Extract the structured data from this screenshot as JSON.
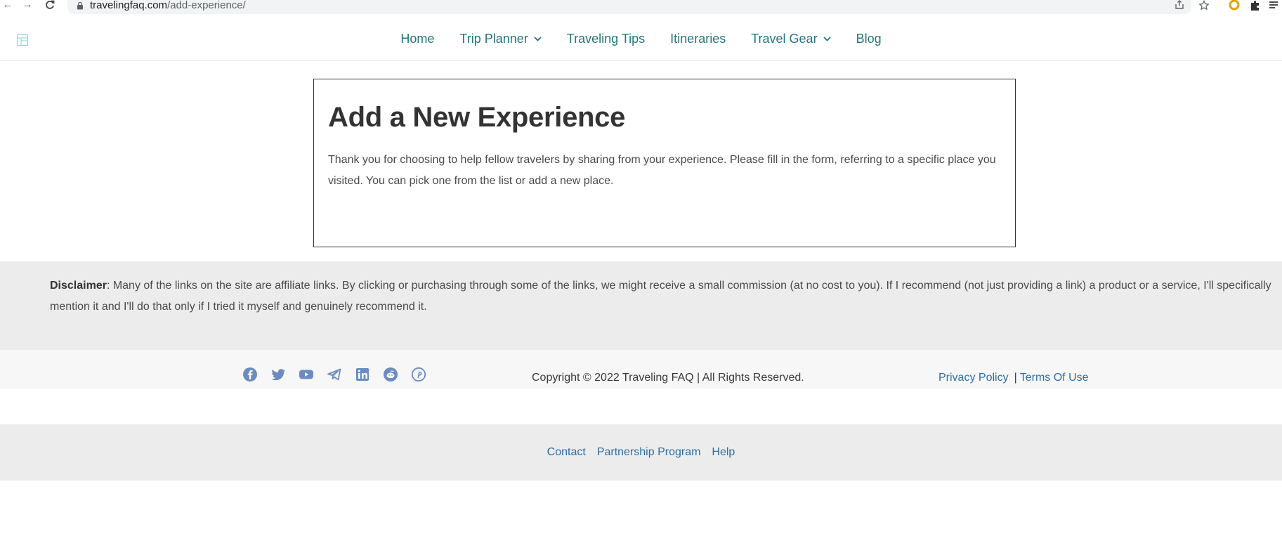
{
  "browser": {
    "url_host": "travelingfaq.com",
    "url_path": "/add-experience/"
  },
  "nav": {
    "items": [
      {
        "label": "Home",
        "has_dropdown": false
      },
      {
        "label": "Trip Planner",
        "has_dropdown": true
      },
      {
        "label": "Traveling Tips",
        "has_dropdown": false
      },
      {
        "label": "Itineraries",
        "has_dropdown": false
      },
      {
        "label": "Travel Gear",
        "has_dropdown": true
      },
      {
        "label": "Blog",
        "has_dropdown": false
      }
    ]
  },
  "main": {
    "title": "Add a New Experience",
    "intro": "Thank you for choosing to help fellow travelers by sharing from your experience. Please fill in the form, referring to a specific place you visited. You can pick one from the list or add a new place."
  },
  "disclaimer": {
    "label": "Disclaimer",
    "text": ": Many of the links on the site are affiliate links. By clicking or purchasing through some of the links, we might receive a small commission (at no cost to you). If I recommend (not just providing a link) a product or a service, I'll specifically mention it and I'll do that only if I tried it myself and genuinely recommend it."
  },
  "footer": {
    "social_icons": [
      "facebook-icon",
      "twitter-icon",
      "youtube-icon",
      "telegram-icon",
      "linkedin-icon",
      "reddit-icon",
      "pinterest-icon"
    ],
    "copyright": "Copyright © 2022 Traveling FAQ | All Rights Reserved.",
    "privacy": "Privacy Policy",
    "separator": "|",
    "terms": "Terms Of Use",
    "bottom_links": [
      "Contact",
      "Partnership Program",
      "Help"
    ]
  },
  "colors": {
    "nav_link": "#22777a",
    "footer_link": "#2c6fa6",
    "social_icon": "#6b8cc0",
    "band_bg": "#ececec"
  }
}
